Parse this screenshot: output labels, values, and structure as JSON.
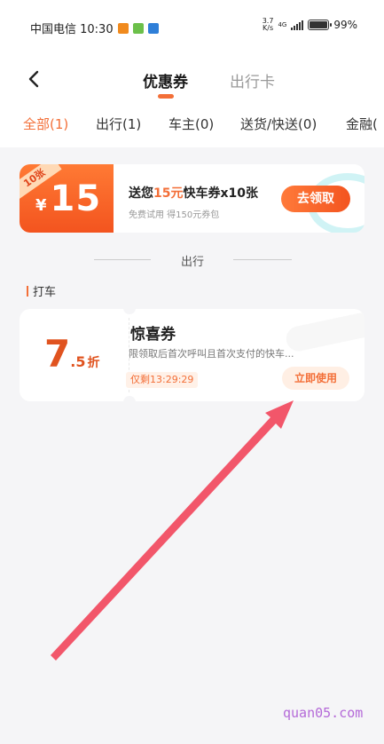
{
  "status_bar": {
    "carrier_time": "中国电信 10:30",
    "speed_value": "3.7",
    "speed_unit": "K/s",
    "network": "4G",
    "battery": "99%",
    "battery_level": 0.99
  },
  "header": {
    "tabs": [
      {
        "label": "优惠券",
        "active": true
      },
      {
        "label": "出行卡",
        "active": false
      }
    ]
  },
  "categories": [
    {
      "label": "全部(1)",
      "active": true
    },
    {
      "label": "出行(1)",
      "active": false
    },
    {
      "label": "车主(0)",
      "active": false
    },
    {
      "label": "送货/快送(0)",
      "active": false
    },
    {
      "label": "金融(",
      "active": false
    }
  ],
  "promo": {
    "ribbon": "10张",
    "currency": "¥",
    "amount": "15",
    "title_prefix": "送您",
    "title_highlight": "15元",
    "title_suffix": "快车券x10张",
    "subtitle": "免费试用 得150元券包",
    "button": "去领取"
  },
  "section_divider": "出行",
  "section_label": "打车",
  "coupon": {
    "discount_int": "7",
    "discount_dec": ".5",
    "discount_unit": "折",
    "title": "惊喜券",
    "description": "限领取后首次呼叫且首次支付的快车...",
    "timer": "仅剩13:29:29",
    "button": "立即使用"
  },
  "watermark": "quan05.com",
  "colors": {
    "accent": "#f36f38",
    "annotation_arrow": "#f2566a"
  }
}
